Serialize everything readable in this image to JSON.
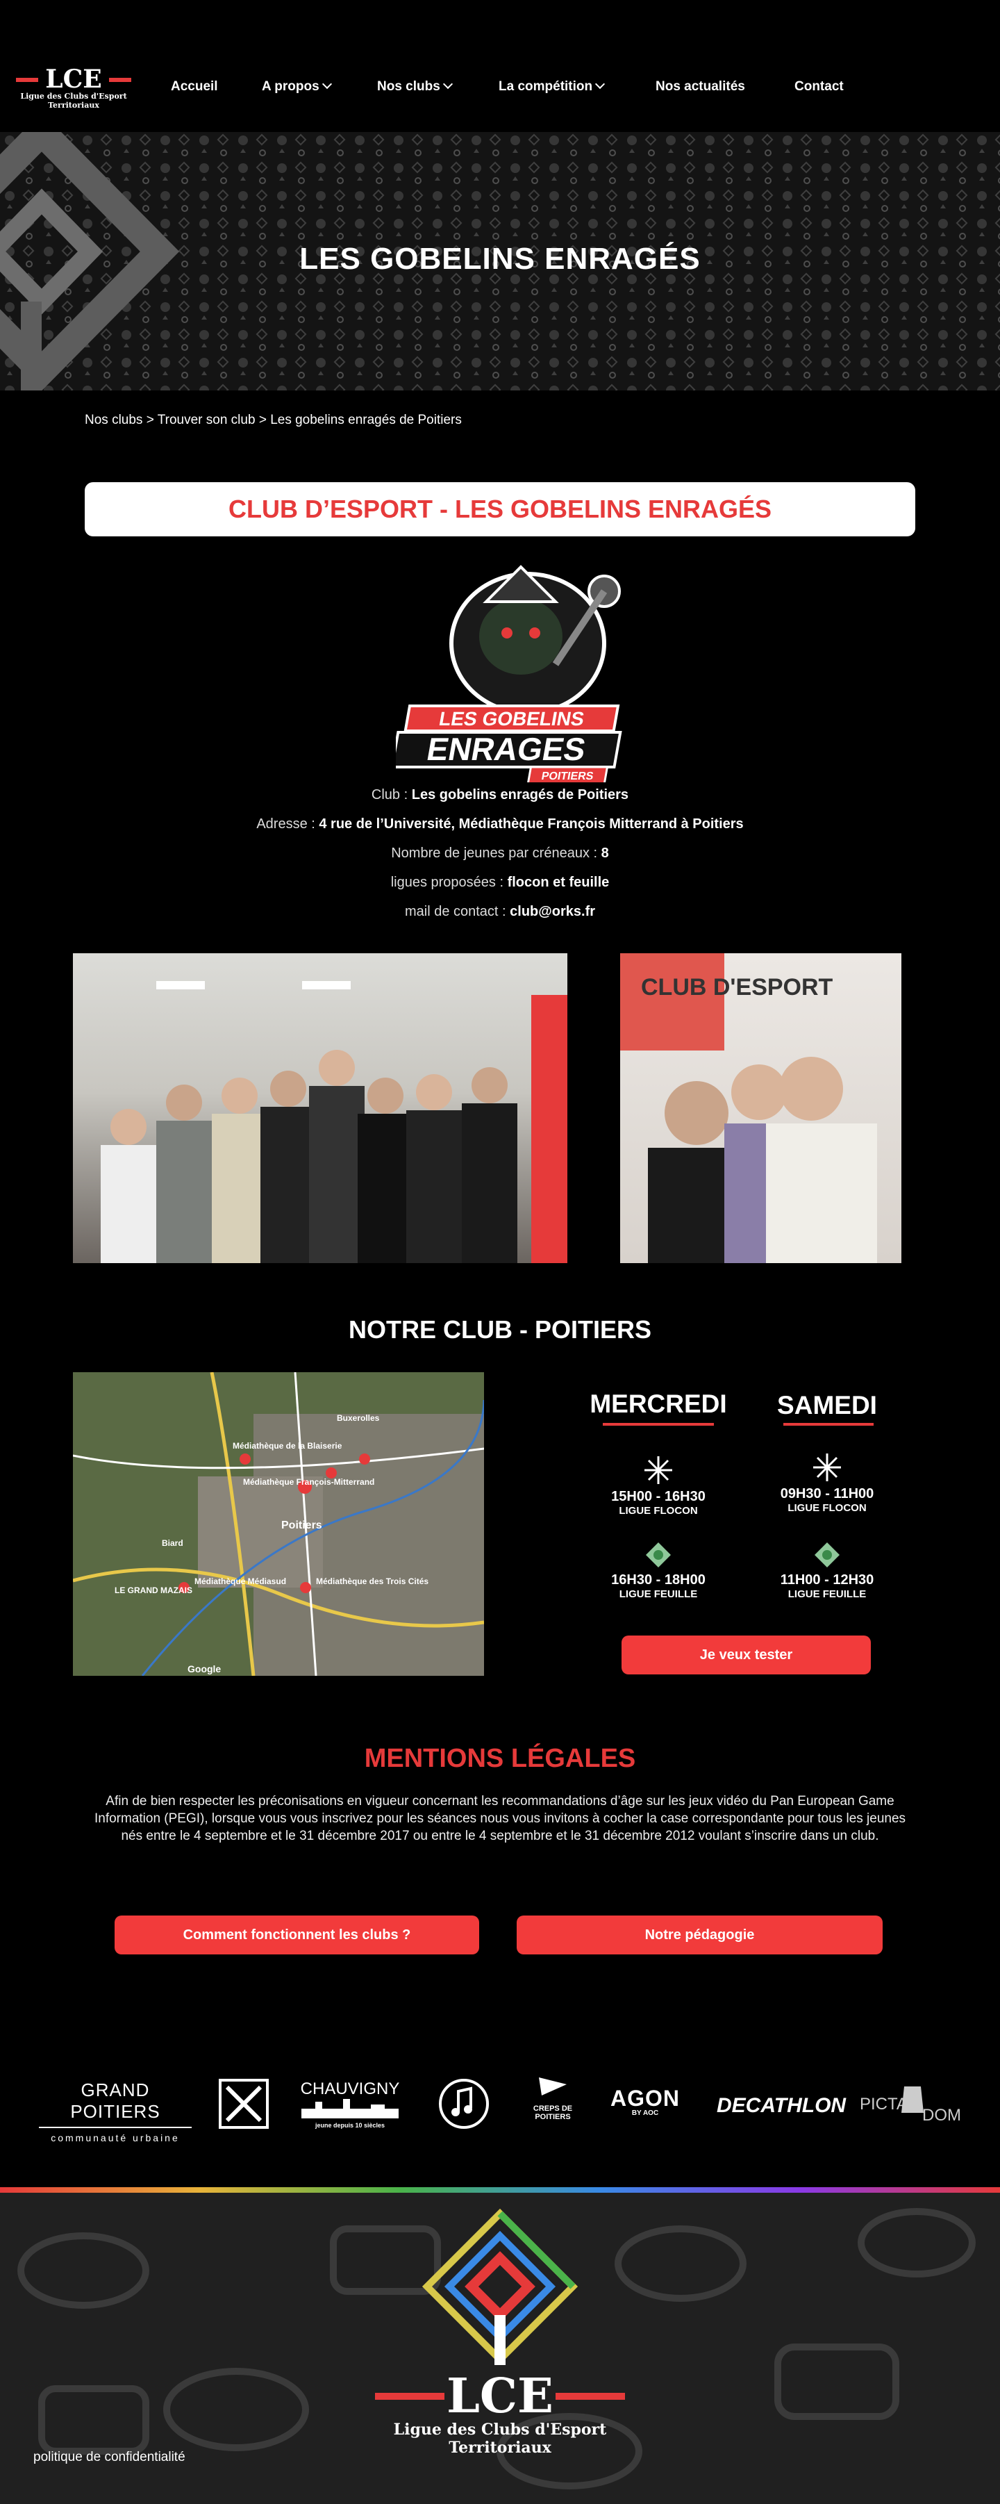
{
  "header": {
    "logo_main": "LCE",
    "logo_sub_1": "Ligue des Clubs d'Esport",
    "logo_sub_2": "Territoriaux",
    "nav": [
      {
        "label": "Accueil"
      },
      {
        "label": "A propos"
      },
      {
        "label": "Nos clubs"
      },
      {
        "label": "La compétition"
      },
      {
        "label": "Nos actualités"
      },
      {
        "label": "Contact"
      }
    ]
  },
  "hero": {
    "title": "LES GOBELINS ENRAGÉS"
  },
  "breadcrumb": "Nos clubs > Trouver son club > Les gobelins enragés de Poitiers",
  "club_title": "CLUB D’ESPORT - LES GOBELINS ENRAGÉS",
  "club_logo": {
    "line1": "LES GOBELINS",
    "line2": "ENRAGES",
    "tag": "POITIERS"
  },
  "info": {
    "club_label": "Club :",
    "club_value": "Les gobelins enragés de Poitiers",
    "address_label": "Adresse :",
    "address_value": "4 rue de l’Université, Médiathèque François Mitterrand à Poitiers",
    "youth_label": "Nombre de jeunes par créneaux :",
    "youth_value": "8",
    "leagues_label": "ligues proposées :",
    "leagues_value": "flocon et feuille",
    "mail_label": "mail de contact :",
    "mail_value": "club@orks.fr"
  },
  "photo_banner_text": "CLUB D'ESPORT",
  "club_section_title": "NOTRE CLUB - POITIERS",
  "map": {
    "labels": [
      "Buxerolles",
      "Médiathèque de la Blaiserie",
      "Médiathèque François-Mitterrand",
      "Poitiers",
      "Biard",
      "LE GRAND MAZAIS",
      "Médiathèque Médiasud",
      "Médiathèque des Trois Cités",
      "Google"
    ]
  },
  "schedule": {
    "days": [
      {
        "name": "MERCREDI",
        "slots": [
          {
            "time": "15H00 - 16H30",
            "league": "LIGUE FLOCON"
          },
          {
            "time": "16H30 - 18H00",
            "league": "LIGUE FEUILLE"
          }
        ]
      },
      {
        "name": "SAMEDI",
        "slots": [
          {
            "time": "09H30 - 11H00",
            "league": "LIGUE FLOCON"
          },
          {
            "time": "11H00 - 12H30",
            "league": "LIGUE FEUILLE"
          }
        ]
      }
    ],
    "cta": "Je veux tester"
  },
  "legal": {
    "title": "MENTIONS LÉGALES",
    "text": "Afin de bien respecter les préconisations en vigueur concernant les recommandations d’âge sur les jeux vidéo du Pan European Game Information (PEGI), lorsque vous vous inscrivez pour les séances nous vous invitons à cocher la case correspondante pour tous les jeunes nés entre le 4 septembre et le 31 décembre 2017 ou entre le 4 septembre et le 31 décembre 2012 voulant s’inscrire dans un club."
  },
  "buttons": {
    "how": "Comment fonctionnent les clubs ?",
    "pedagogy": "Notre pédagogie"
  },
  "partners": {
    "grand_poitiers": "GRAND POITIERS",
    "grand_poitiers_sub": "communauté urbaine",
    "chauvigny": "CHAUVIGNY",
    "chauvigny_sub": "jeune depuis 10 siècles",
    "creps": "CREPS DE POITIERS",
    "agon": "AGON",
    "agon_sub": "BY AOC",
    "decathlon": "DECATHLON",
    "picta": "PICTA",
    "picta_2": "DOM"
  },
  "footer": {
    "logo_main": "LCE",
    "logo_sub_1": "Ligue des Clubs d'Esport",
    "logo_sub_2": "Territoriaux",
    "privacy": "politique de confidentialité"
  },
  "colors": {
    "accent": "#e63a3a",
    "button": "#f23b3b",
    "background": "#000000"
  }
}
